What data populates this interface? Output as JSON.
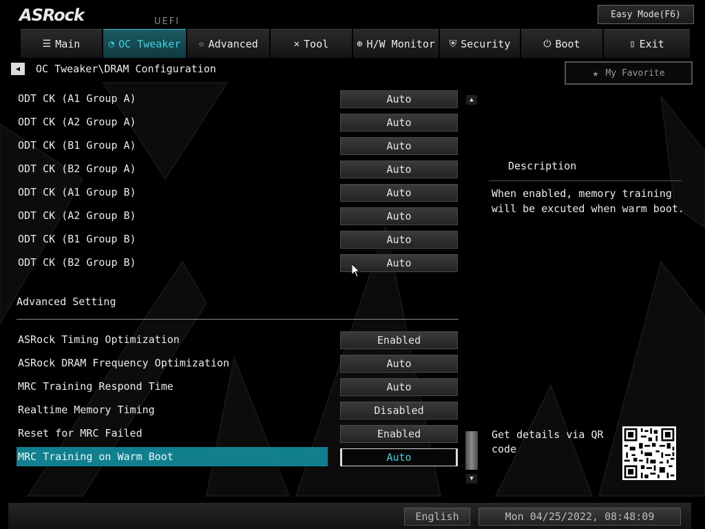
{
  "header": {
    "logo": "ASRock",
    "uefi": "UEFI",
    "easy_mode": "Easy Mode(F6)"
  },
  "tabs": [
    {
      "label": "Main",
      "icon": "list-icon",
      "active": false
    },
    {
      "label": "OC Tweaker",
      "icon": "speedometer-icon",
      "active": true
    },
    {
      "label": "Advanced",
      "icon": "star-swoosh-icon",
      "active": false
    },
    {
      "label": "Tool",
      "icon": "tools-icon",
      "active": false
    },
    {
      "label": "H/W Monitor",
      "icon": "monitor-gauge-icon",
      "active": false
    },
    {
      "label": "Security",
      "icon": "shield-icon",
      "active": false
    },
    {
      "label": "Boot",
      "icon": "power-icon",
      "active": false
    },
    {
      "label": "Exit",
      "icon": "exit-door-icon",
      "active": false
    }
  ],
  "breadcrumb": "OC Tweaker\\DRAM Configuration",
  "favorite_label": "My Favorite",
  "settings": [
    {
      "label": "ODT CK (A1 Group A)",
      "value": "Auto"
    },
    {
      "label": "ODT CK (A2 Group A)",
      "value": "Auto"
    },
    {
      "label": "ODT CK (B1 Group A)",
      "value": "Auto"
    },
    {
      "label": "ODT CK (B2 Group A)",
      "value": "Auto"
    },
    {
      "label": "ODT CK (A1 Group B)",
      "value": "Auto"
    },
    {
      "label": "ODT CK (A2 Group B)",
      "value": "Auto"
    },
    {
      "label": "ODT CK (B1 Group B)",
      "value": "Auto"
    },
    {
      "label": "ODT CK (B2 Group B)",
      "value": "Auto"
    }
  ],
  "section_title": "Advanced Setting",
  "advanced_settings": [
    {
      "label": "ASRock Timing Optimization",
      "value": "Enabled"
    },
    {
      "label": "ASRock DRAM Frequency Optimization",
      "value": "Auto"
    },
    {
      "label": "MRC Training Respond Time",
      "value": "Auto"
    },
    {
      "label": "Realtime Memory Timing",
      "value": "Disabled"
    },
    {
      "label": "Reset for MRC Failed",
      "value": "Enabled"
    },
    {
      "label": "MRC Training on Warm Boot",
      "value": "Auto",
      "selected": true
    }
  ],
  "description": {
    "title": "Description",
    "text": "When enabled, memory training will be excuted when warm boot."
  },
  "qr_text": "Get details via QR code",
  "footer": {
    "language": "English",
    "datetime": "Mon 04/25/2022, 08:48:09"
  },
  "colors": {
    "accent": "#127f8f",
    "accent_text": "#3fd0e0",
    "background": "#000000"
  }
}
